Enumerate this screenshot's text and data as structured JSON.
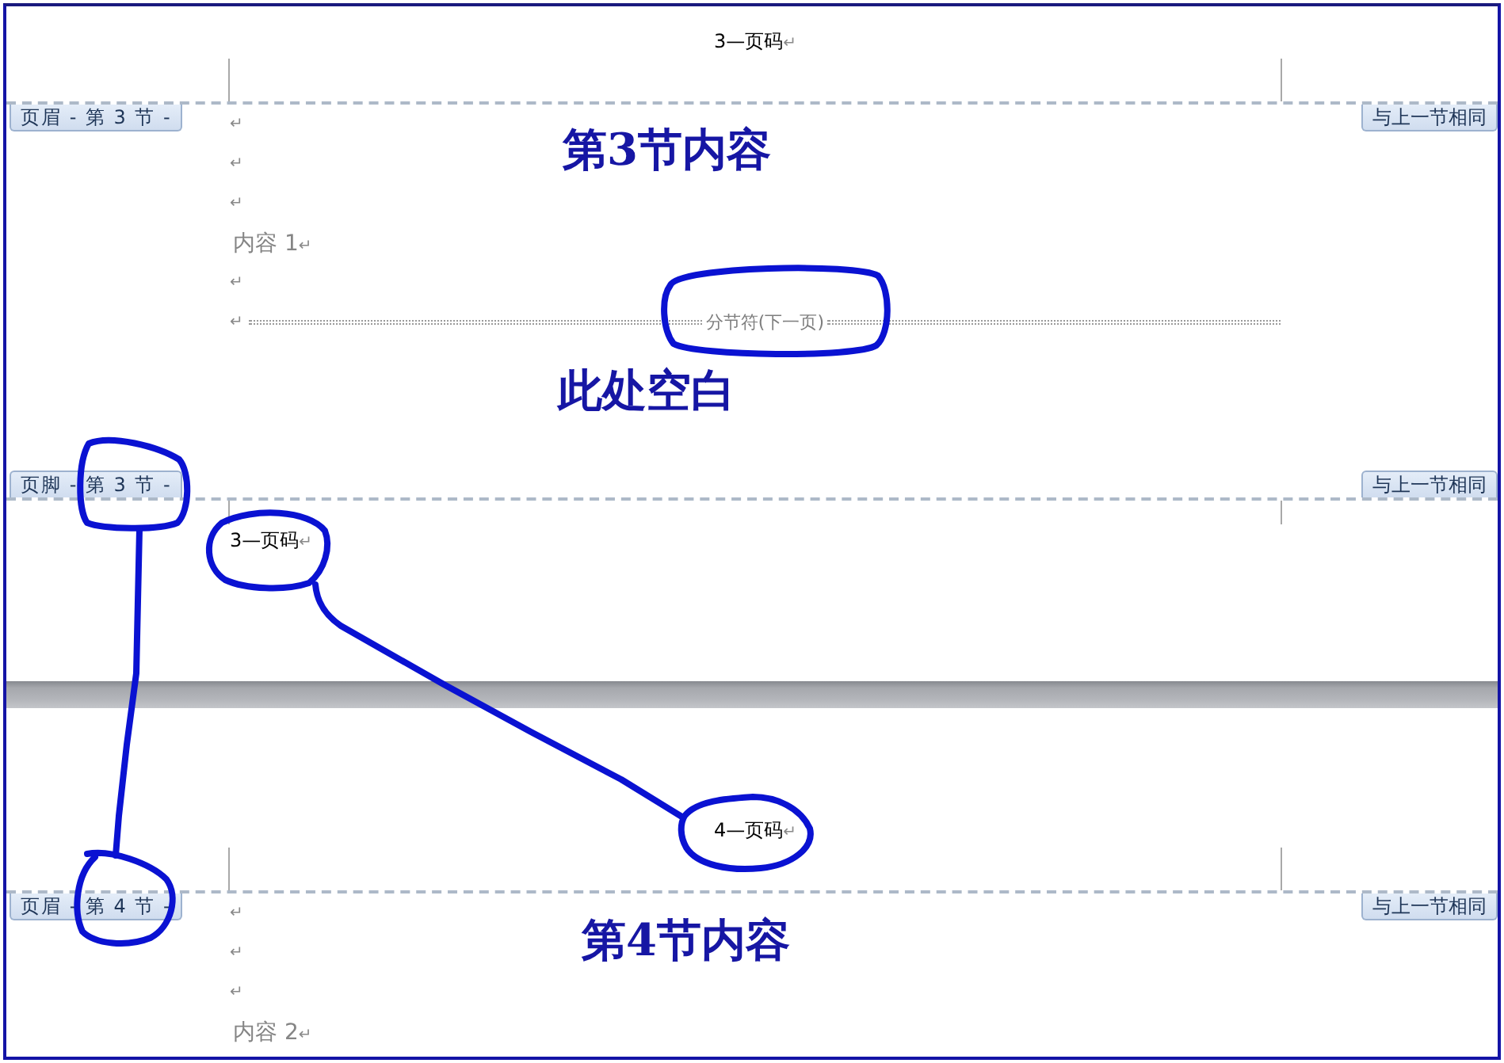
{
  "pages": [
    {
      "header": {
        "section_label": "页眉 - 第 3 节 -",
        "link_label": "与上一节相同",
        "text": "3—页码",
        "mark": "↵"
      },
      "body": [
        {
          "kind": "mark",
          "mark": "↵"
        },
        {
          "kind": "mark",
          "mark": "↵"
        },
        {
          "kind": "mark",
          "mark": "↵"
        },
        {
          "kind": "text",
          "text": "内容 1",
          "mark": "↵"
        },
        {
          "kind": "mark",
          "mark": "↵"
        },
        {
          "kind": "section_break",
          "mark": "↵",
          "text": "分节符(下一页)"
        }
      ],
      "footer": {
        "section_label": "页脚 - 第 3 节 -",
        "link_label": "与上一节相同",
        "text": "3—页码",
        "mark": "↵"
      }
    },
    {
      "header": {
        "section_label": "页眉 - 第 4 节 -",
        "link_label": "与上一节相同",
        "text": "4—页码",
        "mark": "↵"
      },
      "body": [
        {
          "kind": "mark",
          "mark": "↵"
        },
        {
          "kind": "mark",
          "mark": "↵"
        },
        {
          "kind": "mark",
          "mark": "↵"
        },
        {
          "kind": "text",
          "text": "内容 2",
          "mark": "↵"
        }
      ]
    }
  ],
  "annotations": [
    "第3节内容",
    "此处空白",
    "第4节内容"
  ]
}
